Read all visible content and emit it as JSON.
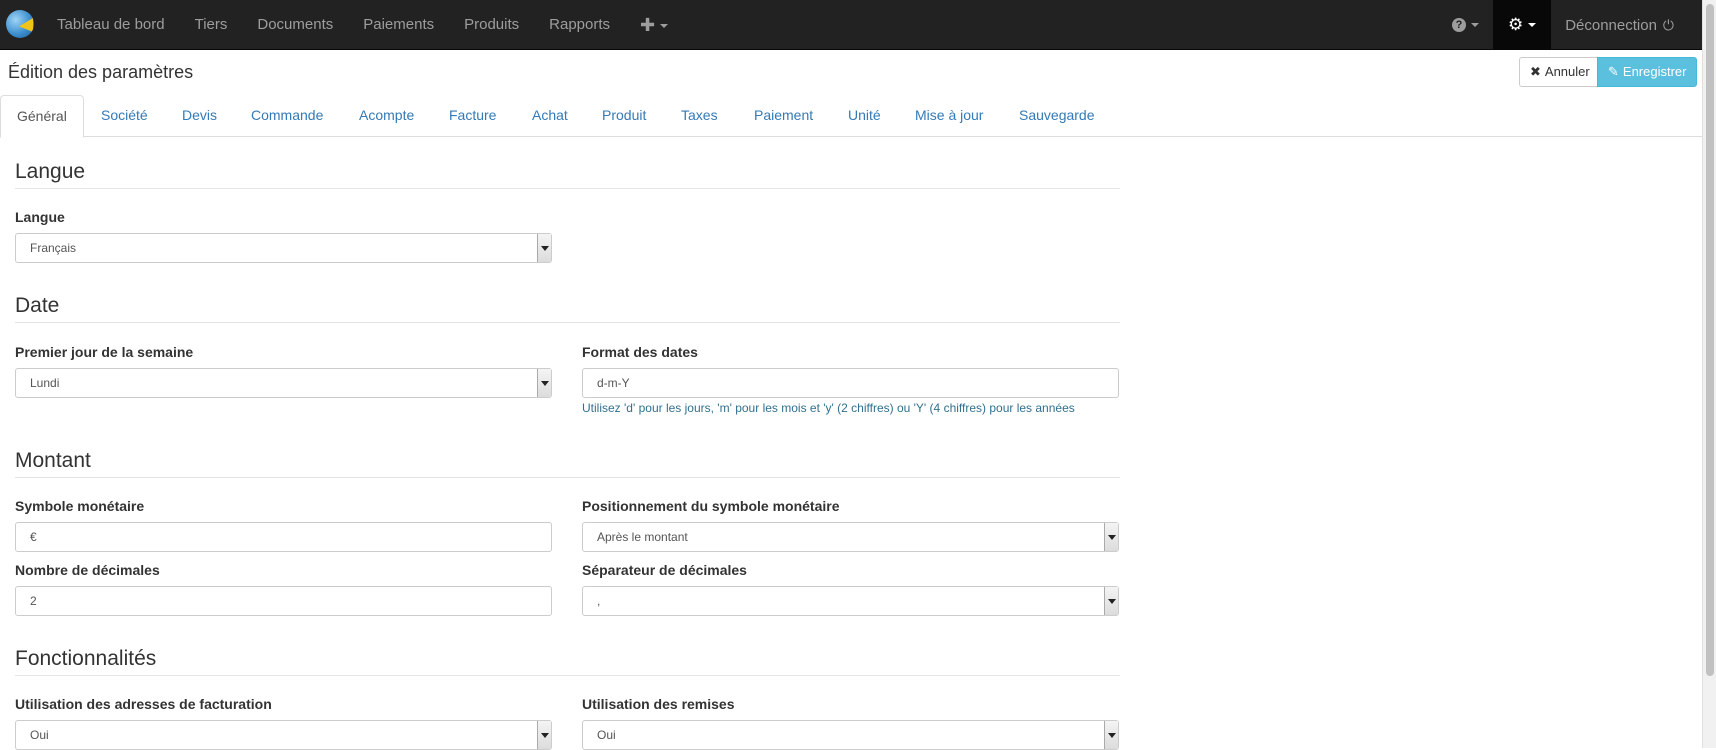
{
  "navbar": {
    "brand_icon": "pie-chart-logo",
    "items": [
      {
        "label": "Tableau de bord"
      },
      {
        "label": "Tiers"
      },
      {
        "label": "Documents"
      },
      {
        "label": "Paiements"
      },
      {
        "label": "Produits"
      },
      {
        "label": "Rapports"
      }
    ],
    "plus_icon": "✚",
    "help_icon": "?",
    "settings_icon": "⚙",
    "logout_label": "Déconnection",
    "logout_icon": "⏻"
  },
  "header": {
    "title": "Édition des paramètres",
    "cancel_label": "Annuler",
    "save_label": "Enregistrer"
  },
  "tabs": [
    {
      "label": "Général",
      "active": true
    },
    {
      "label": "Société"
    },
    {
      "label": "Devis"
    },
    {
      "label": "Commande"
    },
    {
      "label": "Acompte"
    },
    {
      "label": "Facture"
    },
    {
      "label": "Achat"
    },
    {
      "label": "Produit"
    },
    {
      "label": "Taxes"
    },
    {
      "label": "Paiement"
    },
    {
      "label": "Unité"
    },
    {
      "label": "Mise à jour"
    },
    {
      "label": "Sauvegarde"
    }
  ],
  "sections": {
    "langue": {
      "title": "Langue",
      "language_label": "Langue",
      "language_value": "Français"
    },
    "date": {
      "title": "Date",
      "first_day_label": "Premier jour de la semaine",
      "first_day_value": "Lundi",
      "date_format_label": "Format des dates",
      "date_format_value": "d-m-Y",
      "date_format_help": "Utilisez 'd' pour les jours, 'm' pour les mois et 'y' (2 chiffres) ou 'Y' (4 chiffres) pour les années"
    },
    "montant": {
      "title": "Montant",
      "currency_symbol_label": "Symbole monétaire",
      "currency_symbol_value": "€",
      "currency_position_label": "Positionnement du symbole monétaire",
      "currency_position_value": "Après le montant",
      "decimals_label": "Nombre de décimales",
      "decimals_value": "2",
      "decimal_separator_label": "Séparateur de décimales",
      "decimal_separator_value": ","
    },
    "fonctionnalites": {
      "title": "Fonctionnalités",
      "billing_addresses_label": "Utilisation des adresses de facturation",
      "billing_addresses_value": "Oui",
      "discounts_label": "Utilisation des remises",
      "discounts_value": "Oui"
    }
  },
  "colors": {
    "navbar_bg": "#222222",
    "link": "#337ab7",
    "info_button": "#5bc0de",
    "help_text": "#31708f"
  }
}
